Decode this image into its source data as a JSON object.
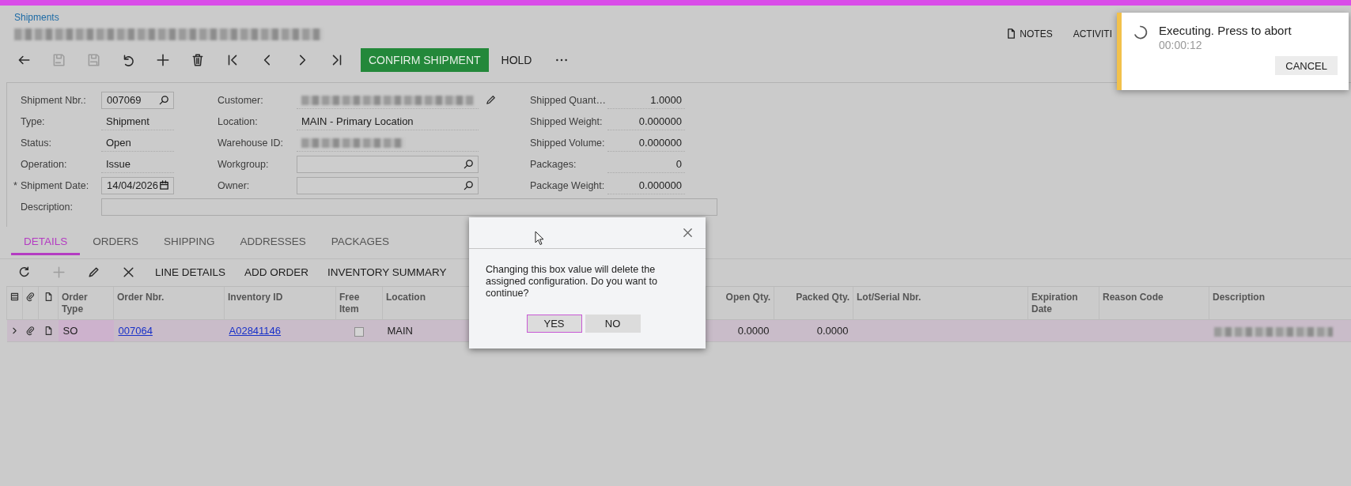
{
  "breadcrumb": "Shipments",
  "toolbar": [
    {
      "kind": "icon",
      "disabled": false
    },
    {
      "kind": "icon",
      "disabled": true
    },
    {
      "kind": "icon",
      "disabled": true
    },
    {
      "kind": "icon",
      "disabled": false
    },
    {
      "kind": "icon",
      "disabled": false
    },
    {
      "kind": "icon",
      "disabled": false
    },
    {
      "kind": "icon",
      "disabled": false
    },
    {
      "kind": "icon",
      "disabled": false
    },
    {
      "kind": "icon",
      "disabled": false
    },
    {
      "kind": "icon",
      "disabled": false
    },
    {
      "kind": "primary",
      "label": "CONFIRM SHIPMENT"
    },
    {
      "kind": "text",
      "label": "HOLD"
    },
    {
      "kind": "icon",
      "disabled": false
    }
  ],
  "header_links": [
    {
      "kind": "note",
      "label": "NOTES"
    },
    {
      "kind": "text",
      "label": "ACTIVITI"
    }
  ],
  "form": {
    "columns": [
      [
        {
          "label": "Shipment Nbr.:",
          "kind": "lookup",
          "value": "007069"
        },
        {
          "label": "Type:",
          "kind": "text",
          "value": "Shipment"
        },
        {
          "label": "Status:",
          "kind": "text",
          "value": "Open"
        },
        {
          "label": "Operation:",
          "kind": "text",
          "value": "Issue"
        },
        {
          "label": "Shipment Date:",
          "kind": "date",
          "value": "14/04/2026",
          "prefix": "*"
        }
      ],
      [
        {
          "label": "Customer:",
          "kind": "blurred-edit"
        },
        {
          "label": "Location:",
          "kind": "text",
          "value": "MAIN - Primary Location"
        },
        {
          "label": "Warehouse ID:",
          "kind": "blurred"
        },
        {
          "label": "Workgroup:",
          "kind": "lookup"
        },
        {
          "label": "Owner:",
          "kind": "lookup"
        }
      ],
      [
        {
          "label": "Shipped Quant…",
          "kind": "number",
          "value": "1.0000"
        },
        {
          "label": "Shipped Weight:",
          "kind": "number",
          "value": "0.000000"
        },
        {
          "label": "Shipped Volume:",
          "kind": "number",
          "value": "0.000000"
        },
        {
          "label": "Packages:",
          "kind": "number",
          "value": "0"
        },
        {
          "label": "Package Weight:",
          "kind": "number",
          "value": "0.000000"
        }
      ]
    ],
    "description": {
      "label": "Description:"
    }
  },
  "tabs": [
    {
      "label": "DETAILS",
      "selected": true
    },
    {
      "label": "ORDERS",
      "selected": false
    },
    {
      "label": "SHIPPING",
      "selected": false
    },
    {
      "label": "ADDRESSES",
      "selected": false
    },
    {
      "label": "PACKAGES",
      "selected": false
    }
  ],
  "grid_toolbar": [
    {
      "kind": "icon",
      "disabled": false
    },
    {
      "kind": "icon",
      "disabled": true
    },
    {
      "kind": "icon",
      "disabled": false
    },
    {
      "kind": "icon",
      "disabled": false
    },
    {
      "kind": "text",
      "label": "LINE DETAILS"
    },
    {
      "kind": "text",
      "label": "ADD ORDER"
    },
    {
      "kind": "text",
      "label": "INVENTORY SUMMARY"
    }
  ],
  "grid": {
    "columns": [
      {
        "kind": "icon"
      },
      {
        "kind": "icon"
      },
      {
        "kind": "icon"
      },
      {
        "kind": "text",
        "label": "Order Type"
      },
      {
        "kind": "text",
        "label": "Order Nbr."
      },
      {
        "kind": "text",
        "label": "Inventory ID"
      },
      {
        "kind": "text",
        "label": "Free Item"
      },
      {
        "kind": "text",
        "label": "Location"
      },
      {
        "kind": "hidden"
      },
      {
        "kind": "number",
        "label": "Open Qty."
      },
      {
        "kind": "number",
        "label": "Packed Qty."
      },
      {
        "kind": "text",
        "label": "Lot/Serial Nbr."
      },
      {
        "kind": "text",
        "label": "Expiration Date"
      },
      {
        "kind": "text",
        "label": "Reason Code"
      },
      {
        "kind": "text",
        "label": "Description"
      }
    ],
    "rows": [
      {
        "selected": true,
        "cells": [
          {
            "kind": "icon"
          },
          {
            "kind": "icon"
          },
          {
            "kind": "icon"
          },
          {
            "kind": "text",
            "value": "SO",
            "focused": true
          },
          {
            "kind": "link",
            "value": "007064"
          },
          {
            "kind": "link",
            "value": "A02841146"
          },
          {
            "kind": "checkbox",
            "checked": false
          },
          {
            "kind": "text",
            "value": "MAIN"
          },
          {
            "kind": "hidden"
          },
          {
            "kind": "number",
            "value": "0.0000"
          },
          {
            "kind": "number",
            "value": "0.0000"
          },
          {
            "kind": "text"
          },
          {
            "kind": "text"
          },
          {
            "kind": "text"
          },
          {
            "kind": "blurred"
          }
        ]
      }
    ]
  },
  "dialog": {
    "message": "Changing this box value will delete the assigned configuration. Do you want to continue?",
    "buttons": [
      {
        "label": "YES",
        "focused": true
      },
      {
        "label": "NO",
        "focused": false
      }
    ]
  },
  "toast": {
    "title": "Executing. Press to abort",
    "timer": "00:00:12",
    "button": "CANCEL"
  }
}
